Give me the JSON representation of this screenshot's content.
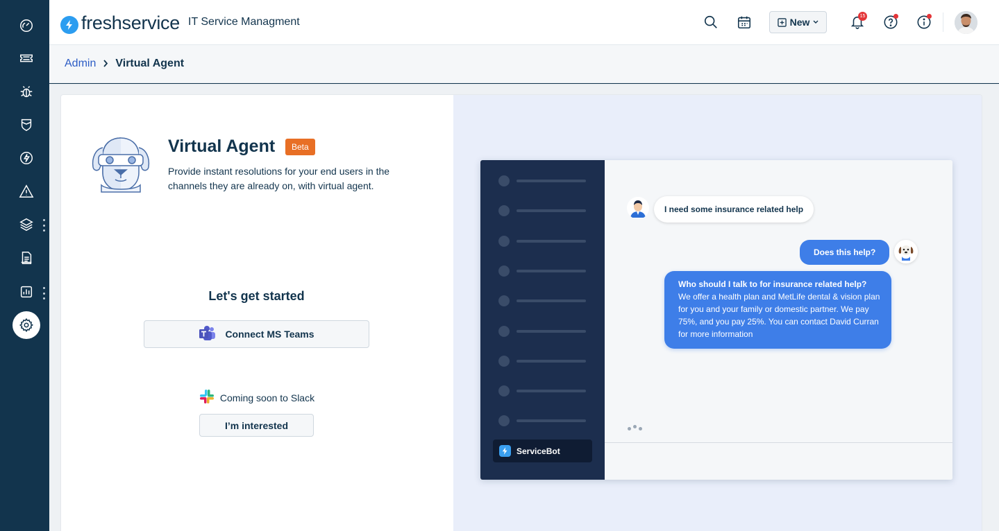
{
  "header": {
    "brand": "freshservice",
    "subtitle": "IT Service Managment",
    "new_label": "New",
    "notification_count": "15"
  },
  "breadcrumb": {
    "parent": "Admin",
    "current": "Virtual Agent"
  },
  "intro": {
    "title": "Virtual Agent",
    "badge": "Beta",
    "description": "Provide instant resolutions for your end users in the channels they are already on, with virtual agent."
  },
  "setup": {
    "heading": "Let's get started",
    "teams_button": "Connect MS Teams",
    "slack_text": "Coming soon to Slack",
    "interested_button": "I’m interested"
  },
  "preview": {
    "user_message": "I need some insurance related help",
    "bot_reply_short": "Does this help?",
    "bot_reply_title": "Who should I talk to for insurance related help?",
    "bot_reply_body": "We offer a health plan and MetLife dental & vision plan for you and your family or domestic partner. We pay 75%, and you pay 25%. You can contact David Curran for more information",
    "bot_name": "ServiceBot"
  },
  "nav_icons": [
    "dashboard-icon",
    "tickets-icon",
    "problems-icon",
    "changes-icon",
    "releases-icon",
    "alert-icon",
    "assets-icon",
    "solutions-icon",
    "reports-icon",
    "admin-settings-icon"
  ],
  "colors": {
    "nav_bg": "#12344d",
    "accent_blue": "#2c5cc5",
    "beta_orange": "#e86f25",
    "bubble_blue": "#3e7ee8",
    "chat_sidebar": "#1c2e4e"
  }
}
